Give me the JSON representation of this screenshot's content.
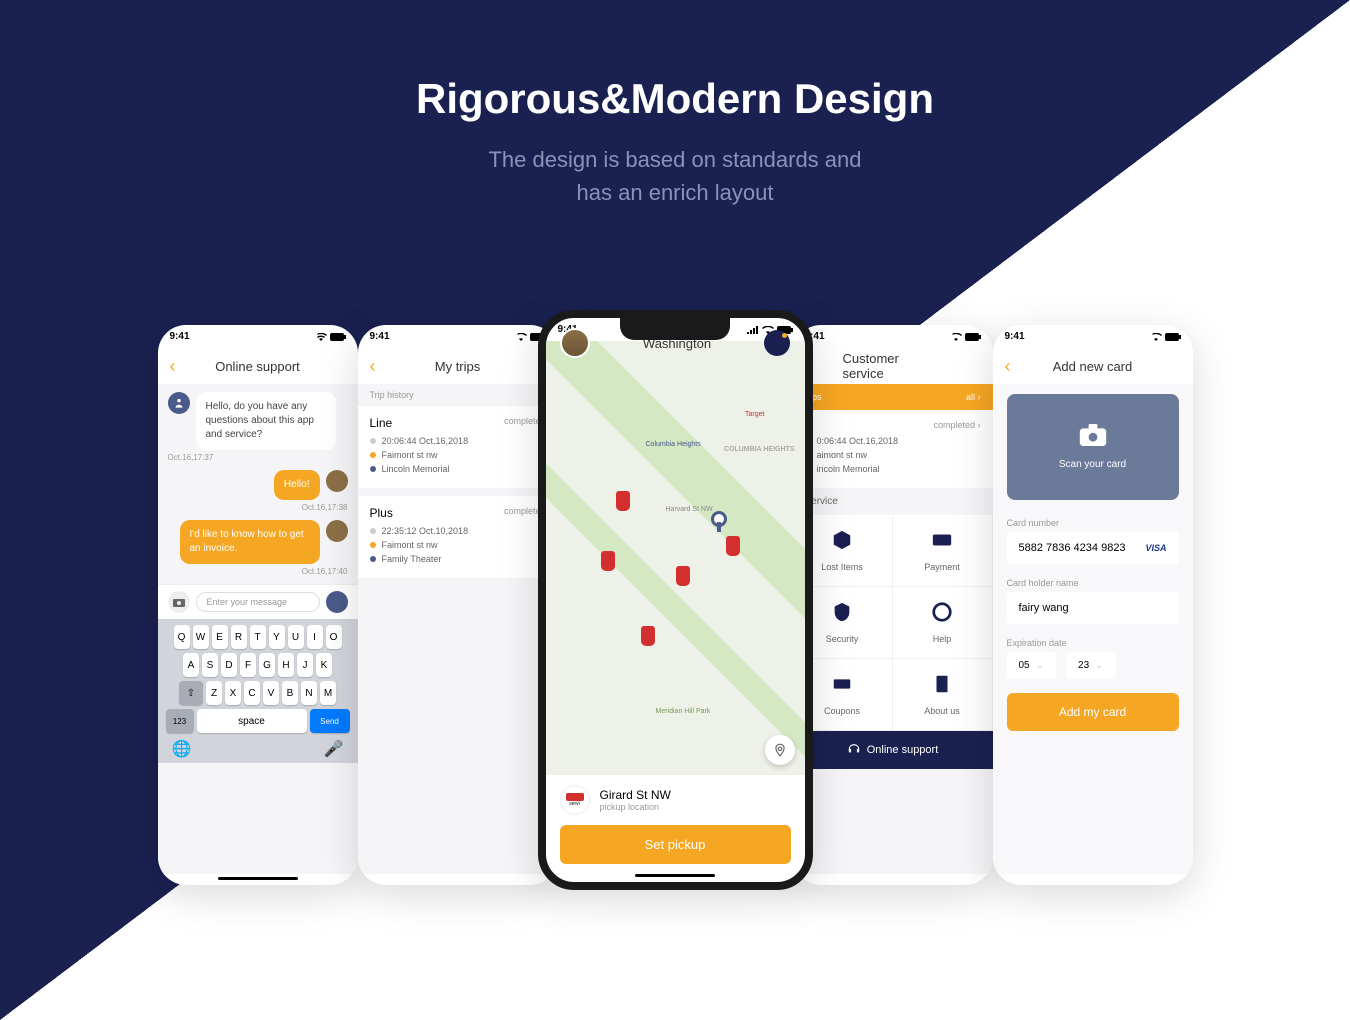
{
  "hero": {
    "title": "Rigorous&Modern Design",
    "subtitle1": "The design is based on standards and",
    "subtitle2": "has an enrich layout"
  },
  "status": {
    "time": "9:41"
  },
  "support": {
    "title": "Online support",
    "bot_msg": "Hello, do you have any questions about this app and service?",
    "bot_time": "Oct.16,17:37",
    "user_msg1": "Hello!",
    "user_time1": "Oct.16,17:38",
    "user_msg2": "I'd like to know how to get an invoice.",
    "user_time2": "Oct.16,17:40",
    "placeholder": "Enter your message",
    "send": "Send",
    "space": "space",
    "num": "123"
  },
  "trips": {
    "title": "My trips",
    "history_label": "Trip history",
    "items": [
      {
        "name": "Line",
        "status": "completed",
        "time": "20:06:44  Oct.16,2018",
        "from": "Faimont st nw",
        "to": "Lincoln Memorial"
      },
      {
        "name": "Plus",
        "status": "completed",
        "time": "22:35:12  Oct.10,2018",
        "from": "Faimont st nw",
        "to": "Family Theater"
      }
    ]
  },
  "map": {
    "city": "Washington",
    "pickup_title": "Girard St NW",
    "pickup_sub": "pickup location",
    "button": "Set pickup",
    "servi": "servi",
    "labels": {
      "target": "Target",
      "columbia": "Columbia Heights",
      "heights": "COLUMBIA HEIGHTS",
      "harvard": "Harvard St NW",
      "meridian": "Meridian Hill Park"
    }
  },
  "cs": {
    "title": "Customer service",
    "banner_left": "trips",
    "banner_right": "all",
    "trip_status": "completed",
    "trip_time": "0:06:44  Oct.16,2018",
    "trip_from": "aimont st nw",
    "trip_to": "incoln Memorial",
    "service_label": "Service",
    "cells": [
      "Lost Items",
      "Payment",
      "Security",
      "Help",
      "Coupons",
      "About us"
    ],
    "support": "Online support"
  },
  "card": {
    "title": "Add new card",
    "scan": "Scan your card",
    "num_label": "Card number",
    "num_value": "5882  7836  4234  9823",
    "name_label": "Card holder name",
    "name_value": "fairy wang",
    "exp_label": "Expiration date",
    "exp_month": "05",
    "exp_year": "23",
    "button": "Add my card",
    "visa": "VISA"
  }
}
